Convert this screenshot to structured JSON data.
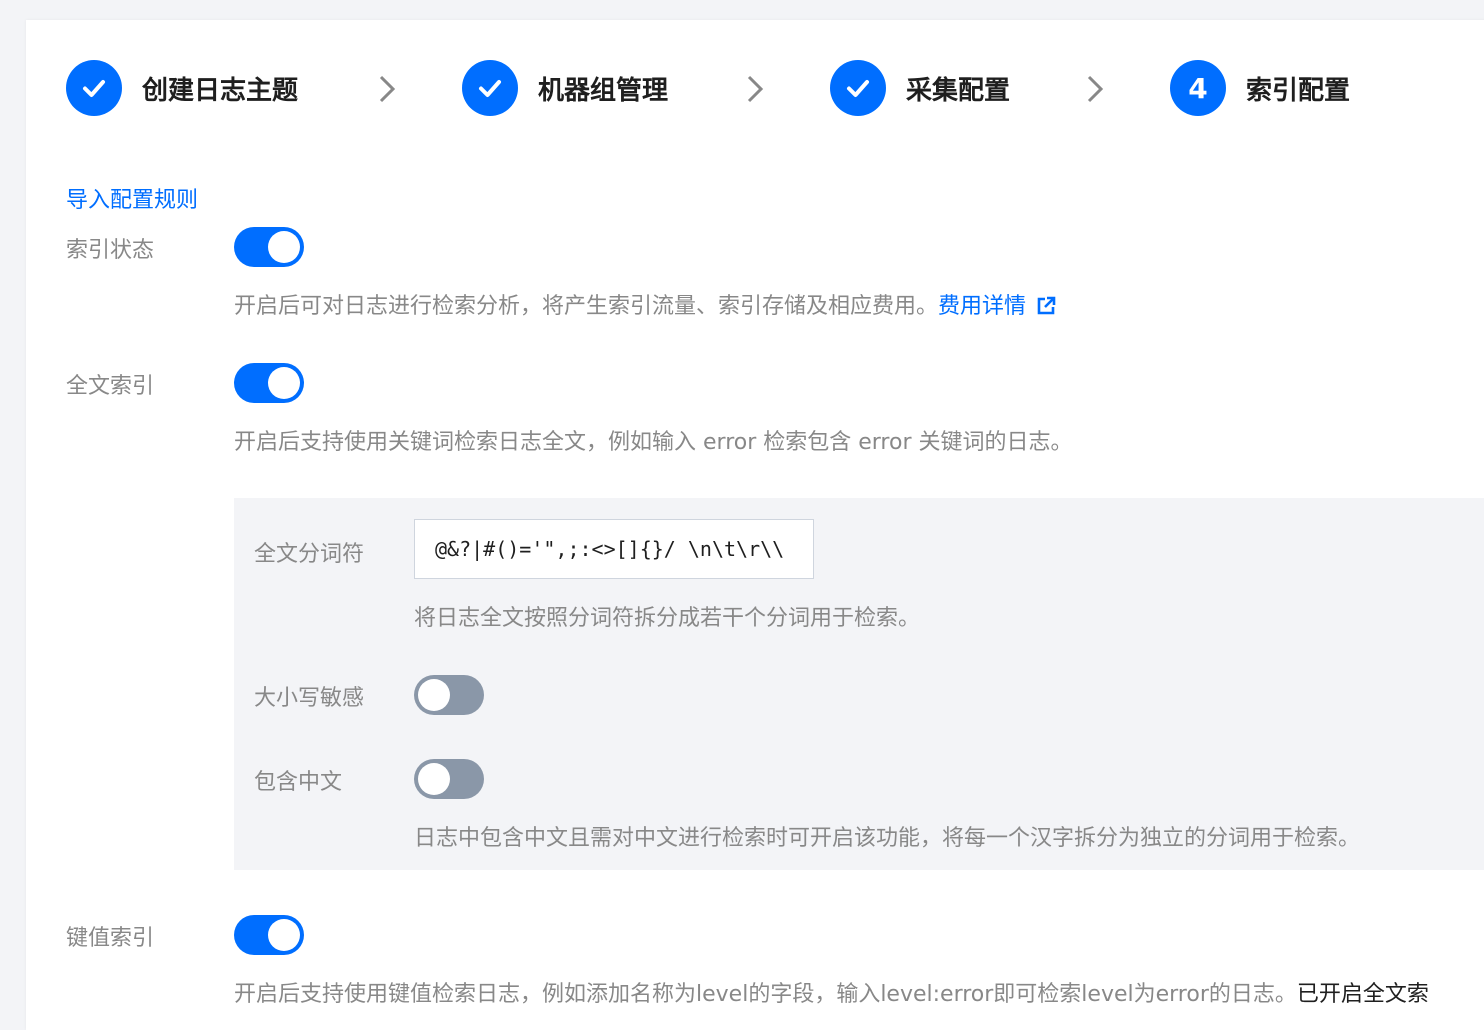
{
  "steps": [
    {
      "label": "创建日志主题",
      "status": "done"
    },
    {
      "label": "机器组管理",
      "status": "done"
    },
    {
      "label": "采集配置",
      "status": "done"
    },
    {
      "label": "索引配置",
      "status": "current",
      "number": "4"
    }
  ],
  "import_link": "导入配置规则",
  "index_status": {
    "label": "索引状态",
    "enabled": true,
    "desc": "开启后可对日志进行检索分析，将产生索引流量、索引存储及相应费用。",
    "fee_link": "费用详情"
  },
  "fulltext": {
    "label": "全文索引",
    "enabled": true,
    "desc": "开启后支持使用关键词检索日志全文，例如输入 error 检索包含 error 关键词的日志。",
    "delimiter_label": "全文分词符",
    "delimiter_value": "@&?|#()='\",;:<>[]{}/ \\n\\t\\r\\\\",
    "delimiter_desc": "将日志全文按照分词符拆分成若干个分词用于检索。",
    "case_label": "大小写敏感",
    "case_enabled": false,
    "chinese_label": "包含中文",
    "chinese_enabled": false,
    "chinese_desc": "日志中包含中文且需对中文进行检索时可开启该功能，将每一个汉字拆分为独立的分词用于检索。"
  },
  "kv": {
    "label": "键值索引",
    "enabled": true,
    "desc": "开启后支持使用键值检索日志，例如添加名称为level的字段，输入level:error即可检索level为error的日志。",
    "desc_dark": "已开启全文索"
  },
  "colors": {
    "accent": "#006eff",
    "toggle_off": "#8a97a8",
    "panel_bg": "#f3f4f7"
  }
}
